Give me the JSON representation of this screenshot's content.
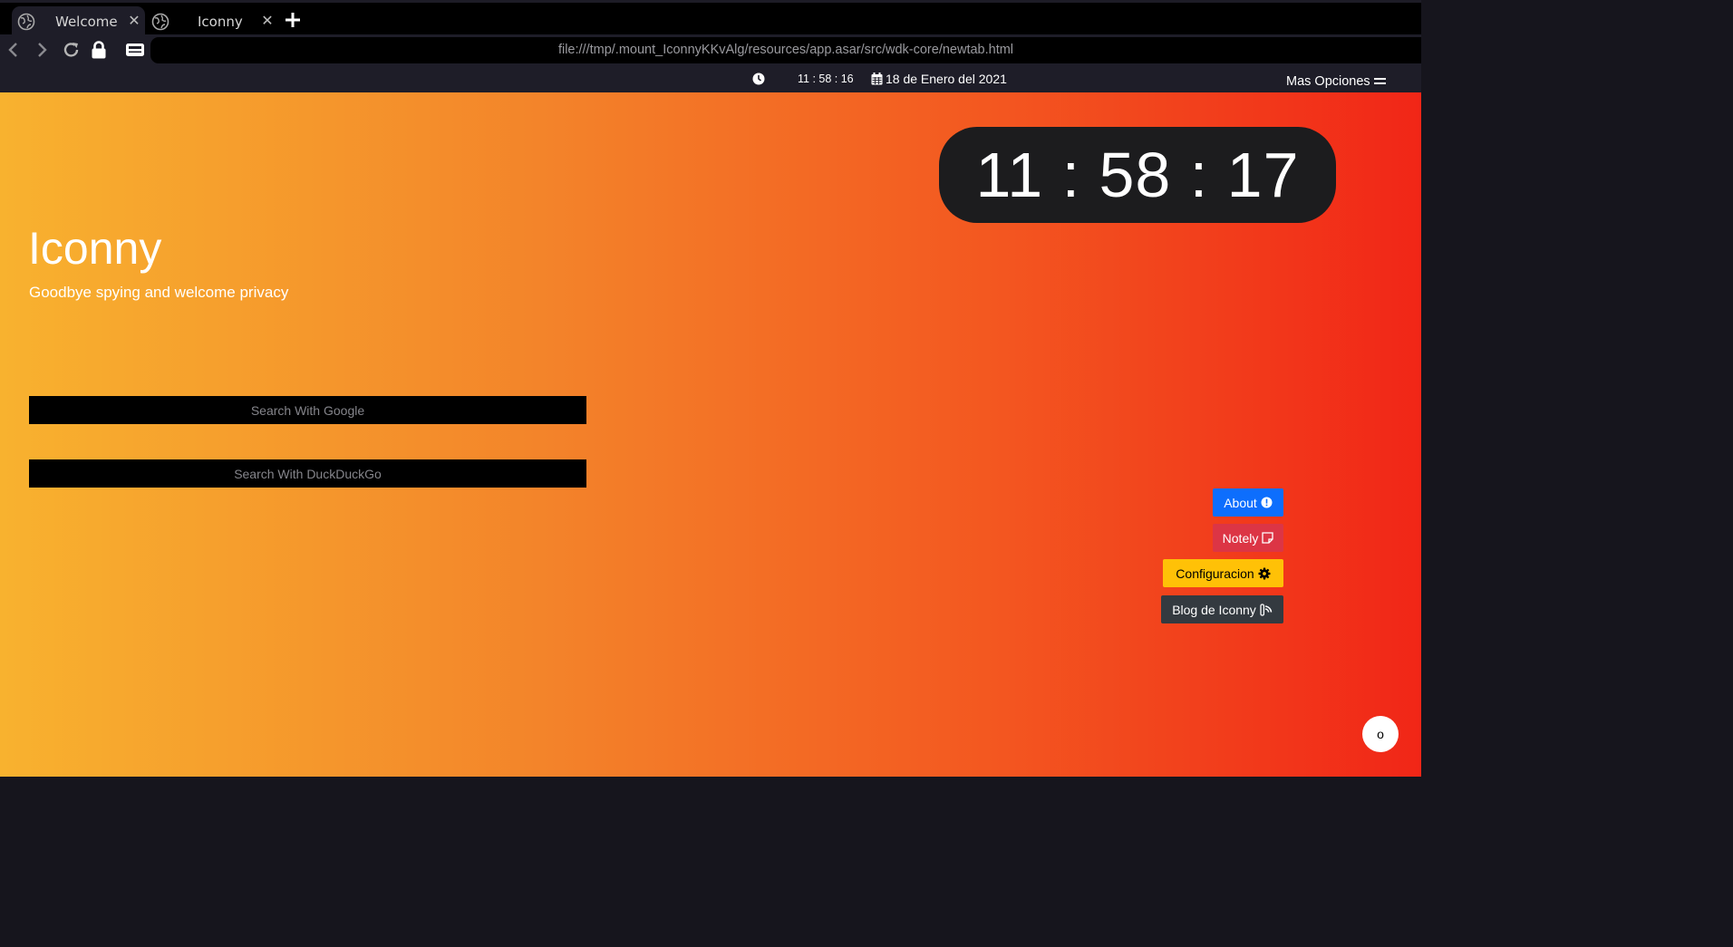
{
  "tabs": [
    {
      "title": "Welcome",
      "icon": "globe-icon",
      "active": true
    },
    {
      "title": "Iconny",
      "icon": "globe-icon",
      "active": false
    }
  ],
  "address_bar": {
    "url": "file:///tmp/.mount_IconnyKKvAlg/resources/app.asar/src/wdk-core/newtab.html"
  },
  "info_bar": {
    "time": "11 : 58 : 16",
    "date": "18 de Enero del 2021",
    "more_options_label": "Mas Opciones"
  },
  "clock": {
    "time": "11 : 58 : 17"
  },
  "hero": {
    "title": "Iconny",
    "subtitle": "Goodbye spying and welcome privacy"
  },
  "search": {
    "google_placeholder": "Search With Google",
    "duckduckgo_placeholder": "Search With DuckDuckGo"
  },
  "side_buttons": {
    "about": "About",
    "notely": "Notely",
    "configuracion": "Configuracion",
    "blog": "Blog de Iconny"
  },
  "fab_label": "o",
  "colors": {
    "gradient_start": "#f8b22f",
    "gradient_end": "#f12617",
    "about": "#0d6efd",
    "notely": "#dc3545",
    "configuracion": "#ffc107",
    "blog": "#343a40",
    "chrome_bg": "#1e1d28"
  }
}
